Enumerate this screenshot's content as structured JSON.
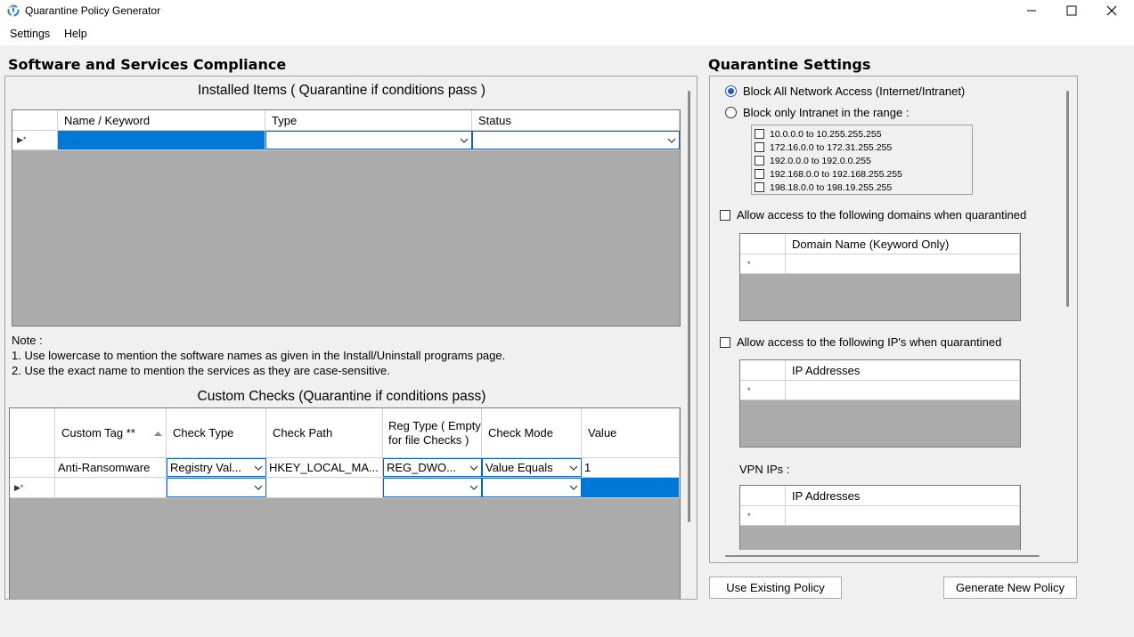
{
  "window": {
    "title": "Quarantine Policy Generator",
    "minimize": "—",
    "maximize": "☐",
    "close": "✕"
  },
  "menu": {
    "items": [
      "Settings",
      "Help"
    ]
  },
  "left": {
    "title": "Software and Services Compliance",
    "installed": {
      "heading": "Installed Items ( Quarantine if conditions pass )",
      "columns": [
        "Name / Keyword",
        "Type",
        "Status"
      ],
      "new_row_marker": "▶*"
    },
    "note": {
      "label": "Note :",
      "line1": "1. Use lowercase to mention the software names as given in the Install/Uninstall programs page.",
      "line2": "2. Use the exact name to mention the services as they are case-sensitive."
    },
    "custom": {
      "heading": "Custom Checks (Quarantine if conditions pass)",
      "columns": [
        "Custom Tag **",
        "Check Type",
        "Check Path",
        "Reg Type ( Empty for file Checks )",
        "Check Mode",
        "Value"
      ],
      "rows": [
        {
          "tag": "Anti-Ransomware",
          "check_type": "Registry Val...",
          "check_path": "HKEY_LOCAL_MA...",
          "reg_type": "REG_DWO...",
          "check_mode": "Value Equals",
          "value": "1"
        }
      ],
      "new_row_marker": "▶*"
    }
  },
  "right": {
    "title": "Quarantine Settings",
    "block_all_label": "Block All Network Access (Internet/Intranet)",
    "block_intranet_label": "Block only Intranet in the range :",
    "ranges": [
      "10.0.0.0 to 10.255.255.255",
      "172.16.0.0 to 172.31.255.255",
      "192.0.0.0 to 192.0.0.255",
      "192.168.0.0 to 192.168.255.255",
      "198.18.0.0 to 198.19.255.255"
    ],
    "allow_domains_label": "Allow access to the following domains when quarantined",
    "domains_column": "Domain Name (Keyword Only)",
    "allow_ips_label": "Allow access to the following IP's when quarantined",
    "ips_column": "IP Addresses",
    "vpn_label": "VPN IPs :",
    "vpn_column": "IP Addresses",
    "new_row_marker": "*"
  },
  "buttons": {
    "use_existing": "Use Existing Policy",
    "generate_new": "Generate New Policy"
  },
  "colors": {
    "selection": "#0078d7",
    "grid_bg": "#ababab"
  }
}
